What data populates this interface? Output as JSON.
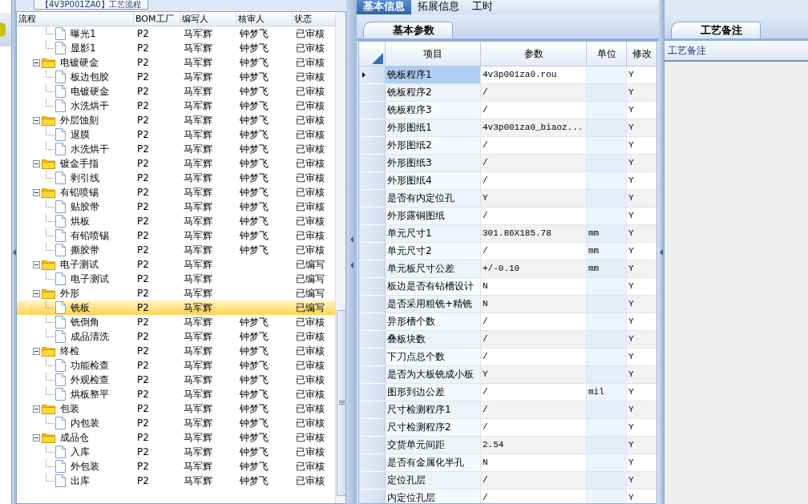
{
  "left_panel": {
    "tab": "【4V3P001ZA0】工艺流程",
    "columns": [
      "流程",
      "BOM工厂",
      "编写人",
      "核审人",
      "状态"
    ],
    "tree": [
      {
        "kind": "file",
        "label": "曝光1",
        "bom": "P2",
        "writer": "马军辉",
        "reviewer": "钟梦飞",
        "status": "已审核",
        "selected": false
      },
      {
        "kind": "file",
        "label": "显影1",
        "bom": "P2",
        "writer": "马军辉",
        "reviewer": "钟梦飞",
        "status": "已审核",
        "selected": false
      },
      {
        "kind": "folder",
        "label": "电镀硬金",
        "bom": "P2",
        "writer": "马军辉",
        "reviewer": "钟梦飞",
        "status": "已审核",
        "expanded": true,
        "selected": false,
        "children": [
          {
            "kind": "file",
            "label": "板边包胶",
            "bom": "P2",
            "writer": "马军辉",
            "reviewer": "钟梦飞",
            "status": "已审核",
            "selected": false
          },
          {
            "kind": "file",
            "label": "电镀硬金",
            "bom": "P2",
            "writer": "马军辉",
            "reviewer": "钟梦飞",
            "status": "已审核",
            "selected": false
          },
          {
            "kind": "file",
            "label": "水洗烘干",
            "bom": "P2",
            "writer": "马军辉",
            "reviewer": "钟梦飞",
            "status": "已审核",
            "selected": false
          }
        ]
      },
      {
        "kind": "folder",
        "label": "外层蚀刻",
        "bom": "P2",
        "writer": "马军辉",
        "reviewer": "钟梦飞",
        "status": "已审核",
        "expanded": true,
        "selected": false,
        "children": [
          {
            "kind": "file",
            "label": "退膜",
            "bom": "P2",
            "writer": "马军辉",
            "reviewer": "钟梦飞",
            "status": "已审核",
            "selected": false
          },
          {
            "kind": "file",
            "label": "水洗烘干",
            "bom": "P2",
            "writer": "马军辉",
            "reviewer": "钟梦飞",
            "status": "已审核",
            "selected": false
          }
        ]
      },
      {
        "kind": "folder",
        "label": "镀金手指",
        "bom": "P2",
        "writer": "马军辉",
        "reviewer": "钟梦飞",
        "status": "已审核",
        "expanded": true,
        "selected": false,
        "children": [
          {
            "kind": "file",
            "label": "剥引线",
            "bom": "P2",
            "writer": "马军辉",
            "reviewer": "钟梦飞",
            "status": "已审核",
            "selected": false
          }
        ]
      },
      {
        "kind": "folder",
        "label": "有铅喷锡",
        "bom": "P2",
        "writer": "马军辉",
        "reviewer": "钟梦飞",
        "status": "已审核",
        "expanded": true,
        "selected": false,
        "children": [
          {
            "kind": "file",
            "label": "贴胶带",
            "bom": "P2",
            "writer": "马军辉",
            "reviewer": "钟梦飞",
            "status": "已审核",
            "selected": false
          },
          {
            "kind": "file",
            "label": "烘板",
            "bom": "P2",
            "writer": "马军辉",
            "reviewer": "钟梦飞",
            "status": "已审核",
            "selected": false
          },
          {
            "kind": "file",
            "label": "有铅喷锡",
            "bom": "P2",
            "writer": "马军辉",
            "reviewer": "钟梦飞",
            "status": "已审核",
            "selected": false
          },
          {
            "kind": "file",
            "label": "撕胶带",
            "bom": "P2",
            "writer": "马军辉",
            "reviewer": "钟梦飞",
            "status": "已审核",
            "selected": false
          }
        ]
      },
      {
        "kind": "folder",
        "label": "电子测试",
        "bom": "P2",
        "writer": "马军辉",
        "status": "已编写",
        "expanded": true,
        "selected": false,
        "children": [
          {
            "kind": "file",
            "label": "电子测试",
            "bom": "P2",
            "writer": "马军辉",
            "status": "已编写",
            "selected": false
          }
        ]
      },
      {
        "kind": "folder",
        "label": "外形",
        "bom": "P2",
        "writer": "马军辉",
        "status": "已编写",
        "expanded": true,
        "selected": false,
        "children": [
          {
            "kind": "file",
            "label": "铣板",
            "bom": "P2",
            "writer": "马军辉",
            "status": "已编写",
            "selected": true
          },
          {
            "kind": "file",
            "label": "铣倒角",
            "bom": "P2",
            "writer": "马军辉",
            "reviewer": "钟梦飞",
            "status": "已审核",
            "selected": false
          },
          {
            "kind": "file",
            "label": "成品清洗",
            "bom": "P2",
            "writer": "马军辉",
            "reviewer": "钟梦飞",
            "status": "已审核",
            "selected": false
          }
        ]
      },
      {
        "kind": "folder",
        "label": "终检",
        "bom": "P2",
        "writer": "马军辉",
        "reviewer": "钟梦飞",
        "status": "已审核",
        "expanded": true,
        "selected": false,
        "children": [
          {
            "kind": "file",
            "label": "功能检查",
            "bom": "P2",
            "writer": "马军辉",
            "reviewer": "钟梦飞",
            "status": "已审核",
            "selected": false
          },
          {
            "kind": "file",
            "label": "外观检查",
            "bom": "P2",
            "writer": "马军辉",
            "reviewer": "钟梦飞",
            "status": "已审核",
            "selected": false
          },
          {
            "kind": "file",
            "label": "烘板整平",
            "bom": "P2",
            "writer": "马军辉",
            "reviewer": "钟梦飞",
            "status": "已审核",
            "selected": false
          }
        ]
      },
      {
        "kind": "folder",
        "label": "包装",
        "bom": "P2",
        "writer": "马军辉",
        "reviewer": "钟梦飞",
        "status": "已审核",
        "expanded": true,
        "selected": false,
        "children": [
          {
            "kind": "file",
            "label": "内包装",
            "bom": "P2",
            "writer": "马军辉",
            "reviewer": "钟梦飞",
            "status": "已审核",
            "selected": false
          }
        ]
      },
      {
        "kind": "folder",
        "label": "成品仓",
        "bom": "P2",
        "writer": "马军辉",
        "reviewer": "钟梦飞",
        "status": "已审核",
        "expanded": true,
        "selected": false,
        "children": [
          {
            "kind": "file",
            "label": "入库",
            "bom": "P2",
            "writer": "马军辉",
            "reviewer": "钟梦飞",
            "status": "已审核",
            "selected": false
          },
          {
            "kind": "file",
            "label": "外包装",
            "bom": "P2",
            "writer": "马军辉",
            "reviewer": "钟梦飞",
            "status": "已审核",
            "selected": false
          },
          {
            "kind": "file",
            "label": "出库",
            "bom": "P2",
            "writer": "马军辉",
            "reviewer": "钟梦飞",
            "status": "已审核",
            "selected": false
          }
        ]
      }
    ]
  },
  "main": {
    "tabs": [
      {
        "label": "基本信息",
        "selected": true
      },
      {
        "label": "拓展信息",
        "selected": false
      },
      {
        "label": "工时",
        "selected": false
      }
    ],
    "subtab": "基本参数",
    "grid": {
      "columns": [
        "项目",
        "参数",
        "单位",
        "修改"
      ],
      "rows": [
        {
          "item": "铣板程序1",
          "value": "4v3p001za0.rou",
          "modified": "Y",
          "selected": true
        },
        {
          "item": "铣板程序2",
          "value": "/",
          "modified": "Y",
          "selected": false
        },
        {
          "item": "铣板程序3",
          "value": "/",
          "modified": "Y",
          "selected": false
        },
        {
          "item": "外形图纸1",
          "value": "4v3p001za0_biaoz...",
          "modified": "Y",
          "selected": false
        },
        {
          "item": "外形图纸2",
          "value": "/",
          "modified": "Y",
          "selected": false
        },
        {
          "item": "外形图纸3",
          "value": "/",
          "modified": "Y",
          "selected": false
        },
        {
          "item": "外形图纸4",
          "value": "/",
          "modified": "Y",
          "selected": false
        },
        {
          "item": "是否有内定位孔",
          "value": "Y",
          "modified": "Y",
          "selected": false
        },
        {
          "item": "外形露铜图纸",
          "value": "/",
          "modified": "Y",
          "selected": false
        },
        {
          "item": "单元尺寸1",
          "value": "301.86X185.78",
          "unit": "mm",
          "modified": "Y",
          "selected": false
        },
        {
          "item": "单元尺寸2",
          "value": "/",
          "unit": "mm",
          "modified": "Y",
          "selected": false
        },
        {
          "item": "单元板尺寸公差",
          "value": "+/-0.10",
          "unit": "mm",
          "modified": "Y",
          "selected": false
        },
        {
          "item": "板边是否有钻槽设计",
          "value": "N",
          "modified": "Y",
          "selected": false
        },
        {
          "item": "是否采用粗铣+精铣",
          "value": "N",
          "modified": "Y",
          "selected": false
        },
        {
          "item": "异形槽个数",
          "value": "/",
          "modified": "Y",
          "selected": false
        },
        {
          "item": "叠板块数",
          "value": "/",
          "modified": "Y",
          "selected": false
        },
        {
          "item": "下刀点总个数",
          "value": "/",
          "modified": "Y",
          "selected": false
        },
        {
          "item": "是否为大板铣成小板",
          "value": "Y",
          "modified": "Y",
          "selected": false
        },
        {
          "item": "图形到边公差",
          "value": "/",
          "unit": "mil",
          "modified": "Y",
          "selected": false
        },
        {
          "item": "尺寸检测程序1",
          "value": "/",
          "modified": "Y",
          "selected": false
        },
        {
          "item": "尺寸检测程序2",
          "value": "/",
          "modified": "Y",
          "selected": false
        },
        {
          "item": "交货单元间距",
          "value": "2.54",
          "modified": "Y",
          "selected": false
        },
        {
          "item": "是否有金属化半孔",
          "value": "N",
          "modified": "Y",
          "selected": false
        },
        {
          "item": "定位孔层",
          "value": "/",
          "modified": "Y",
          "selected": false
        },
        {
          "item": "内定位孔层",
          "value": "/",
          "modified": "Y",
          "selected": false
        }
      ]
    }
  },
  "notes_panel": {
    "tab": "工艺备注",
    "header": "工艺备注"
  }
}
